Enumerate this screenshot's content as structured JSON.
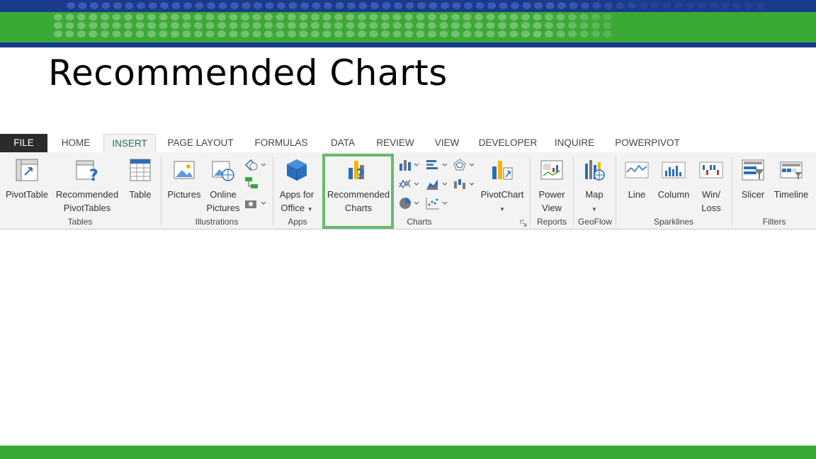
{
  "slide": {
    "title": "Recommended Charts"
  },
  "ribbon": {
    "tabs": [
      "FILE",
      "HOME",
      "INSERT",
      "PAGE LAYOUT",
      "FORMULAS",
      "DATA",
      "REVIEW",
      "VIEW",
      "DEVELOPER",
      "INQUIRE",
      "POWERPIVOT"
    ],
    "active_tab": "INSERT",
    "groups": {
      "tables": {
        "label": "Tables",
        "pivottable": "PivotTable",
        "recommended_pivottables_1": "Recommended",
        "recommended_pivottables_2": "PivotTables",
        "table": "Table"
      },
      "illustrations": {
        "label": "Illustrations",
        "pictures": "Pictures",
        "online_pictures_1": "Online",
        "online_pictures_2": "Pictures"
      },
      "apps": {
        "label": "Apps",
        "apps_for_office_1": "Apps for",
        "apps_for_office_2": "Office"
      },
      "charts": {
        "label": "Charts",
        "recommended_charts_1": "Recommended",
        "recommended_charts_2": "Charts",
        "pivotchart": "PivotChart"
      },
      "reports": {
        "label": "Reports",
        "power_view_1": "Power",
        "power_view_2": "View"
      },
      "geoflow": {
        "label": "GeoFlow",
        "map": "Map"
      },
      "sparklines": {
        "label": "Sparklines",
        "line": "Line",
        "column": "Column",
        "winloss_1": "Win/",
        "winloss_2": "Loss"
      },
      "filters": {
        "label": "Filters",
        "slicer": "Slicer",
        "timeline": "Timeline"
      }
    }
  },
  "colors": {
    "banner_blue": "#1a3a8c",
    "banner_green": "#3aaa35",
    "highlight": "#66bb6a",
    "excel_green": "#217346"
  }
}
